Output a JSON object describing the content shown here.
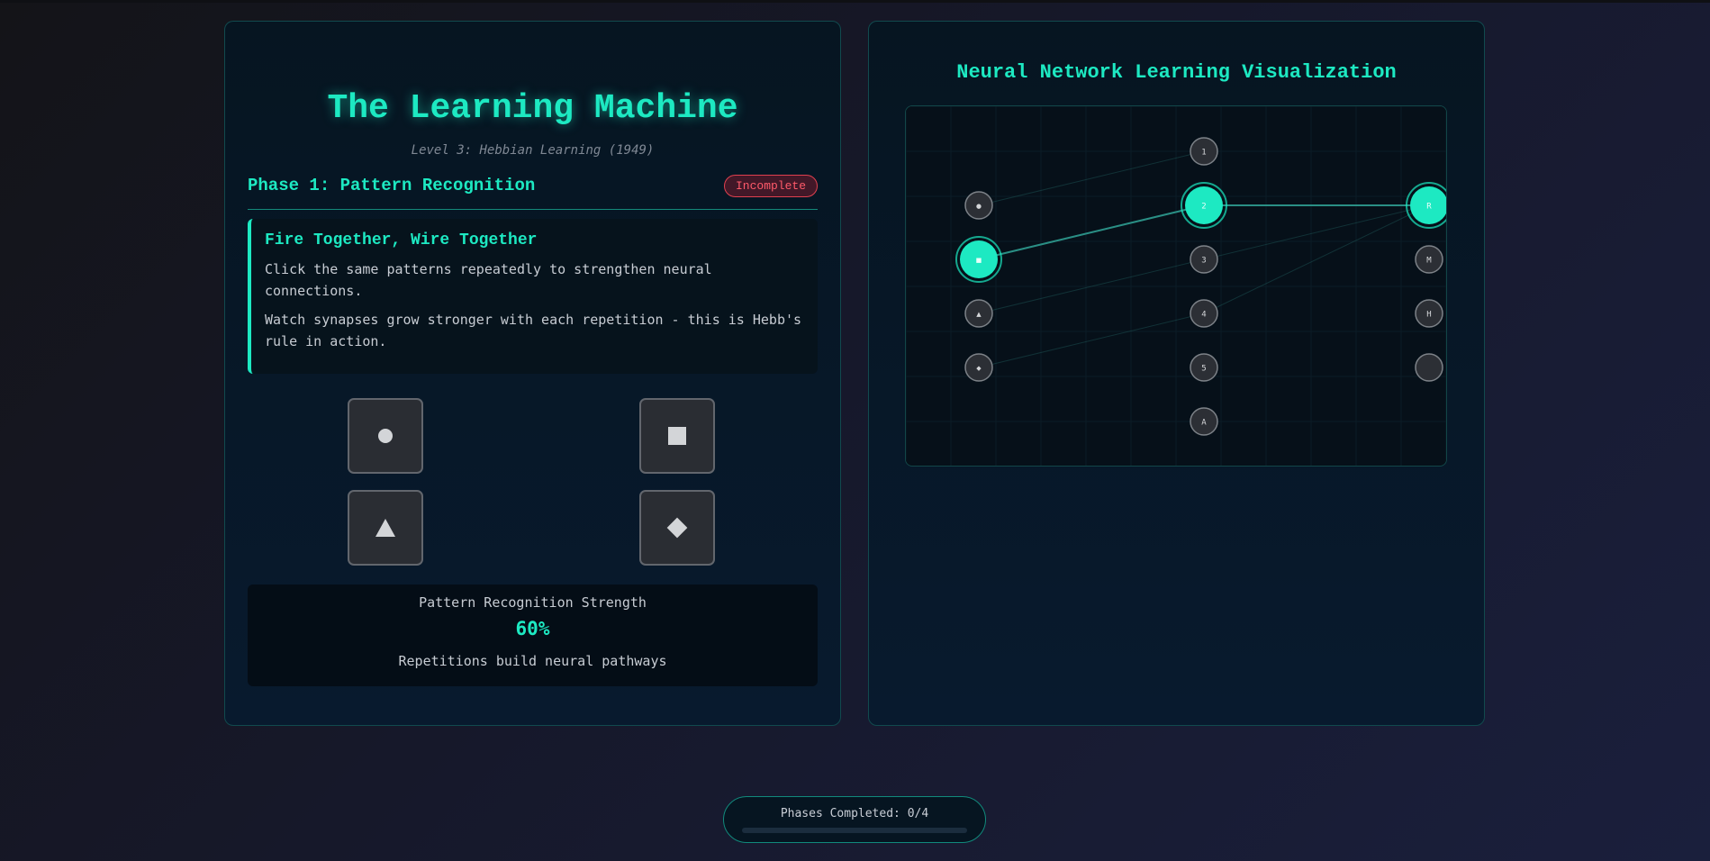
{
  "app": {
    "title": "The Learning Machine",
    "subtitle": "Level 3: Hebbian Learning (1949)"
  },
  "phase": {
    "title": "Phase 1: Pattern Recognition",
    "status": "Incomplete"
  },
  "info": {
    "heading": "Fire Together, Wire Together",
    "paragraph1": "Click the same patterns repeatedly to strengthen neural connections.",
    "paragraph2": "Watch synapses grow stronger with each repetition - this is Hebb's rule in action."
  },
  "patterns": [
    {
      "name": "circle",
      "icon": "circle-icon"
    },
    {
      "name": "square",
      "icon": "square-icon"
    },
    {
      "name": "triangle",
      "icon": "triangle-icon"
    },
    {
      "name": "diamond",
      "icon": "diamond-icon"
    }
  ],
  "strength": {
    "label": "Pattern Recognition Strength",
    "value": "60%",
    "note": "Repetitions build neural pathways"
  },
  "visualization": {
    "title": "Neural Network Learning Visualization",
    "input_nodes": [
      {
        "label": "●",
        "active": false
      },
      {
        "label": "■",
        "active": true
      },
      {
        "label": "▲",
        "active": false
      },
      {
        "label": "◆",
        "active": false
      }
    ],
    "hidden_nodes": [
      {
        "label": "1",
        "active": false
      },
      {
        "label": "2",
        "active": true
      },
      {
        "label": "3",
        "active": false
      },
      {
        "label": "4",
        "active": false
      },
      {
        "label": "5",
        "active": false
      },
      {
        "label": "A",
        "active": false
      }
    ],
    "output_nodes": [
      {
        "label": "R",
        "active": true
      },
      {
        "label": "M",
        "active": false
      },
      {
        "label": "H",
        "active": false
      },
      {
        "label": "",
        "active": false
      }
    ],
    "colors": {
      "active": "#1de9c2",
      "inactive": "#2c2f35",
      "edge": "#2a8f85"
    }
  },
  "progress": {
    "text": "Phases Completed: 0/4",
    "completed": 0,
    "total": 4
  }
}
